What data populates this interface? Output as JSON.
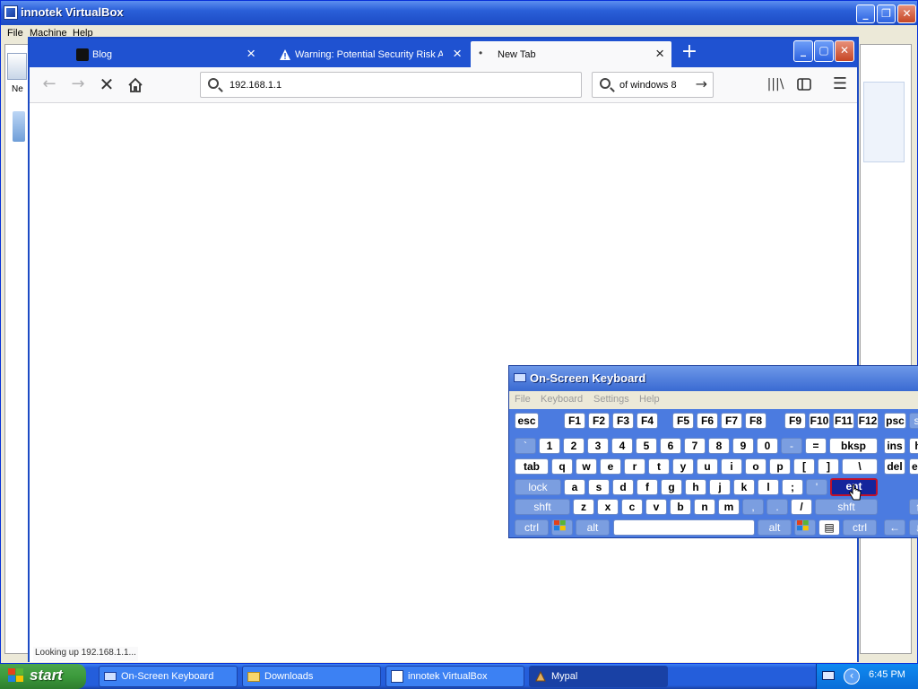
{
  "vbox": {
    "title": "innotek VirtualBox",
    "menu": [
      "File",
      "Machine",
      "Help"
    ],
    "left_label": "Ne"
  },
  "firefox": {
    "tabs": [
      {
        "label": "Blog",
        "active": false
      },
      {
        "label": "Warning: Potential Security Risk A",
        "active": false
      },
      {
        "label": "New Tab",
        "active": true
      }
    ],
    "new_tab_symbol": "+",
    "url": "192.168.1.1",
    "search": "of windows 8",
    "status": "Looking up 192.168.1.1..."
  },
  "osk": {
    "title": "On-Screen Keyboard",
    "menu": [
      "File",
      "Keyboard",
      "Settings",
      "Help"
    ],
    "keys": {
      "r1": [
        "esc",
        "F1",
        "F2",
        "F3",
        "F4",
        "F5",
        "F6",
        "F7",
        "F8",
        "F9",
        "F10",
        "F11",
        "F12",
        "psc",
        "sl"
      ],
      "r2": [
        "`",
        "1",
        "2",
        "3",
        "4",
        "5",
        "6",
        "7",
        "8",
        "9",
        "0",
        "-",
        "=",
        "bksp",
        "ins",
        "h"
      ],
      "r3": [
        "tab",
        "q",
        "w",
        "e",
        "r",
        "t",
        "y",
        "u",
        "i",
        "o",
        "p",
        "[",
        "]",
        "\\",
        "del",
        "en"
      ],
      "r4": [
        "lock",
        "a",
        "s",
        "d",
        "f",
        "g",
        "h",
        "j",
        "k",
        "l",
        ";",
        "'",
        "ent"
      ],
      "r5": [
        "shft",
        "z",
        "x",
        "c",
        "v",
        "b",
        "n",
        "m",
        ",",
        ".",
        "/",
        "shft"
      ],
      "r6": [
        "ctrl",
        "alt",
        "alt",
        "ctrl",
        "←"
      ]
    }
  },
  "taskbar": {
    "start_label": "start",
    "tasks": [
      {
        "label": "On-Screen Keyboard",
        "active": false
      },
      {
        "label": "Downloads",
        "active": false
      },
      {
        "label": "innotek VirtualBox",
        "active": false
      },
      {
        "label": "Mypal",
        "active": true
      }
    ],
    "clock": "6:45 PM"
  }
}
